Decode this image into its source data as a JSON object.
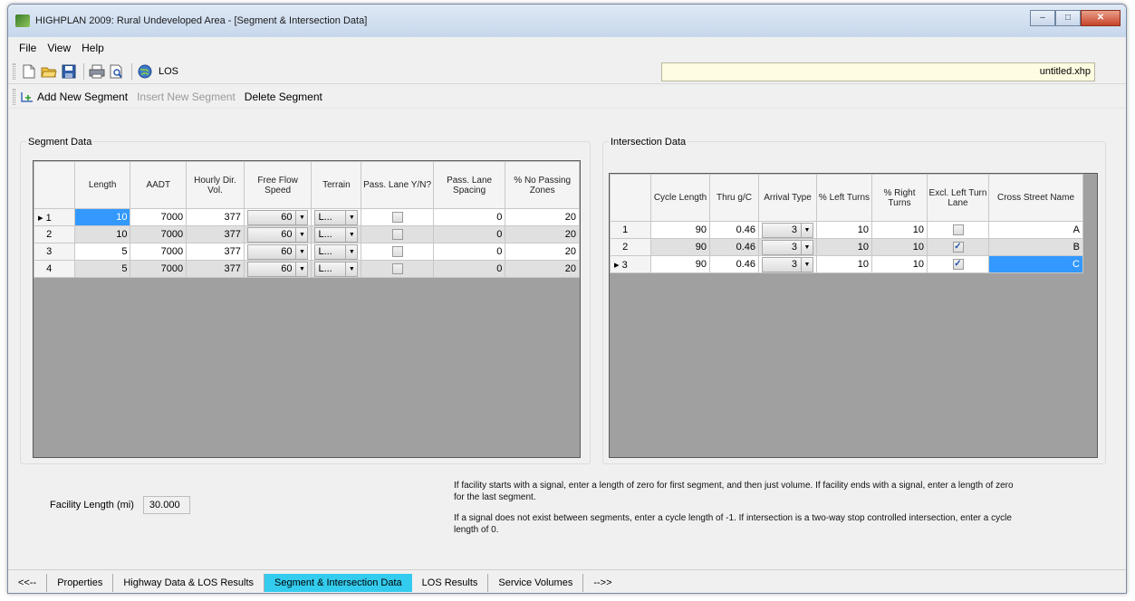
{
  "window": {
    "title": "HIGHPLAN 2009: Rural Undeveloped Area - [Segment & Intersection Data]",
    "controls": [
      "–",
      "□",
      "✕"
    ]
  },
  "menu": [
    "File",
    "View",
    "Help"
  ],
  "toolbar": {
    "los_label": "LOS",
    "filename": "untitled.xhp"
  },
  "actions": {
    "add": "Add New Segment",
    "insert": "Insert New Segment",
    "delete": "Delete Segment"
  },
  "segment": {
    "title": "Segment Data",
    "headers": [
      "Length",
      "AADT",
      "Hourly Dir. Vol.",
      "Free Flow Speed",
      "Terrain",
      "Pass. Lane Y/N?",
      "Pass. Lane Spacing",
      "% No Passing Zones"
    ],
    "rows": [
      {
        "num": "1",
        "length": "10",
        "aadt": "7000",
        "vol": "377",
        "ffs": "60",
        "terrain": "L...",
        "pass_lane": false,
        "spacing": "0",
        "nopass": "20"
      },
      {
        "num": "2",
        "length": "10",
        "aadt": "7000",
        "vol": "377",
        "ffs": "60",
        "terrain": "L...",
        "pass_lane": false,
        "spacing": "0",
        "nopass": "20"
      },
      {
        "num": "3",
        "length": "5",
        "aadt": "7000",
        "vol": "377",
        "ffs": "60",
        "terrain": "L...",
        "pass_lane": false,
        "spacing": "0",
        "nopass": "20"
      },
      {
        "num": "4",
        "length": "5",
        "aadt": "7000",
        "vol": "377",
        "ffs": "60",
        "terrain": "L...",
        "pass_lane": false,
        "spacing": "0",
        "nopass": "20"
      }
    ]
  },
  "intersection": {
    "title": "Intersection Data",
    "headers": [
      "Cycle Length",
      "Thru g/C",
      "Arrival Type",
      "% Left Turns",
      "% Right Turns",
      "Excl. Left Turn Lane",
      "Cross Street Name"
    ],
    "rows": [
      {
        "num": "1",
        "cycle": "90",
        "gc": "0.46",
        "arrival": "3",
        "left": "10",
        "right": "10",
        "excl": false,
        "name": "A"
      },
      {
        "num": "2",
        "cycle": "90",
        "gc": "0.46",
        "arrival": "3",
        "left": "10",
        "right": "10",
        "excl": true,
        "name": "B"
      },
      {
        "num": "3",
        "cycle": "90",
        "gc": "0.46",
        "arrival": "3",
        "left": "10",
        "right": "10",
        "excl": true,
        "name": "C"
      }
    ]
  },
  "facility": {
    "label": "Facility Length (mi)",
    "value": "30.000"
  },
  "notes": {
    "note1": "If facility starts with a signal, enter a length of zero for first segment, and then just volume. If facility ends with a signal, enter a length of zero for the last segment.",
    "note2": "If a signal does not exist between segments, enter a cycle length of -1. If intersection is a two-way stop controlled intersection, enter a cycle length of 0."
  },
  "tabs": [
    "<<--",
    "Properties",
    "Highway Data & LOS Results",
    "Segment & Intersection Data",
    "LOS Results",
    "Service Volumes",
    "-->>"
  ],
  "active_tab": "Segment & Intersection Data"
}
